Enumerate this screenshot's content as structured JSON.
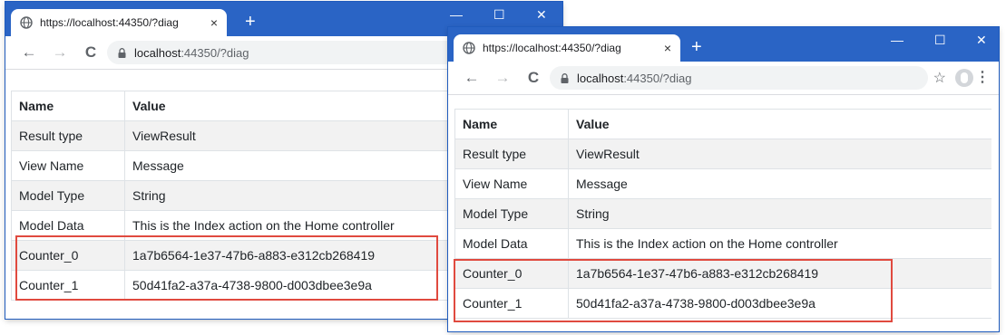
{
  "browser": {
    "tab_title": "https://localhost:44350/?diag",
    "tab_close": "×",
    "new_tab": "+",
    "url_host": "localhost",
    "url_rest": ":44350/?diag",
    "back": "←",
    "forward": "→",
    "reload": "C",
    "minimize": "—",
    "maximize": "☐",
    "close": "✕",
    "bookmark": "☆",
    "menu": "⋮"
  },
  "table": {
    "headers": [
      "Name",
      "Value"
    ],
    "rows": [
      [
        "Result type",
        "ViewResult"
      ],
      [
        "View Name",
        "Message"
      ],
      [
        "Model Type",
        "String"
      ],
      [
        "Model Data",
        "This is the Index action on the Home controller"
      ],
      [
        "Counter_0",
        "1a7b6564-1e37-47b6-a883-e312cb268419"
      ],
      [
        "Counter_1",
        "50d41fa2-a37a-4738-9800-d003dbee3e9a"
      ]
    ]
  },
  "colors": {
    "titlebar": "#2a64c5",
    "highlight": "#e04a3f"
  }
}
